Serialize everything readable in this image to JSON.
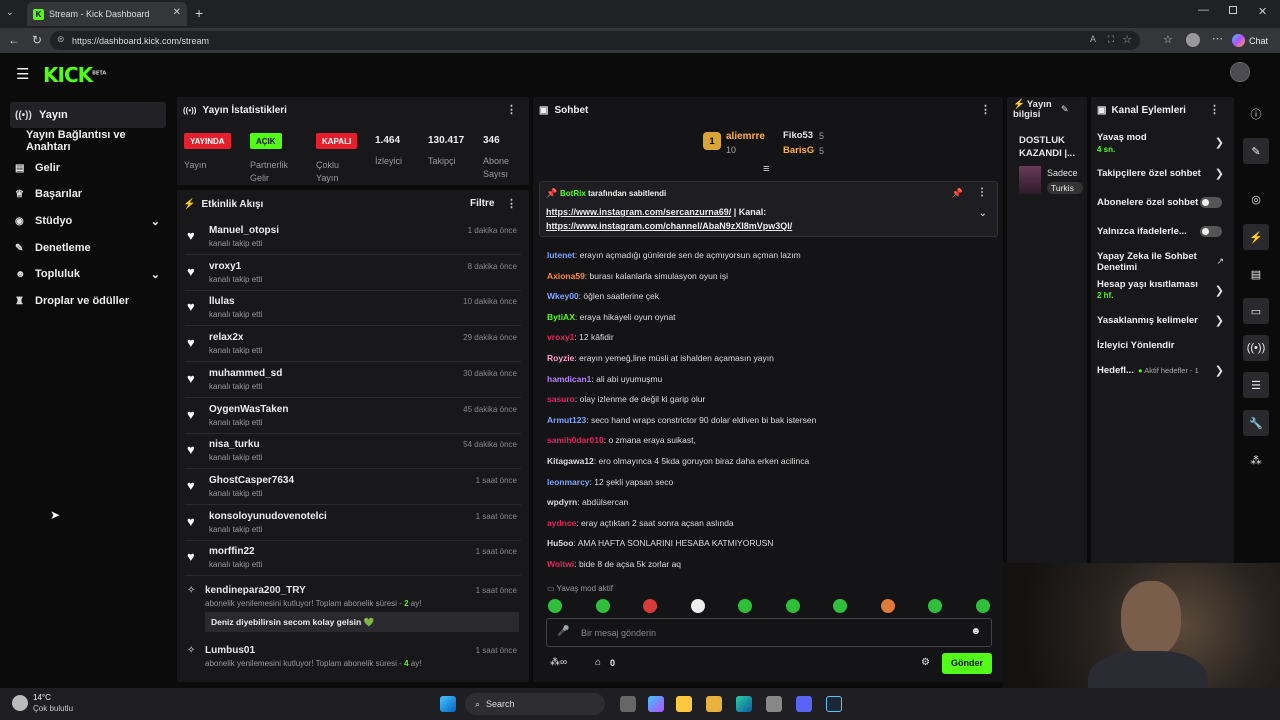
{
  "browser": {
    "tab_title": "Stream - Kick Dashboard",
    "url": "https://dashboard.kick.com/stream",
    "chat_button": "Chat"
  },
  "app": {
    "logo": "KICK",
    "logo_sup": "BETA"
  },
  "sidebar": {
    "items": [
      {
        "label": "Yayın",
        "icon": "broadcast-icon"
      },
      {
        "label": "Yayın Bağlantısı ve Anahtarı",
        "icon": ""
      },
      {
        "label": "Gelir",
        "icon": "chart-icon"
      },
      {
        "label": "Başarılar",
        "icon": "trophy-icon"
      },
      {
        "label": "Stüdyo",
        "icon": "palette-icon"
      },
      {
        "label": "Denetleme",
        "icon": "wrench-icon"
      },
      {
        "label": "Topluluk",
        "icon": "people-icon"
      },
      {
        "label": "Droplar ve ödüller",
        "icon": "gift-icon"
      }
    ]
  },
  "stats": {
    "title": "Yayın İstatistikleri",
    "yayin_badge": "YAYINDA",
    "yayin_label": "Yayın",
    "partner_badge": "AÇIK",
    "partner_label": "Partnerlik Gelir",
    "multi_badge": "KAPALI",
    "multi_label": "Çoklu Yayın",
    "viewers": "1.464",
    "viewers_label": "İzleyici",
    "followers": "130.417",
    "followers_label": "Takipçi",
    "subs": "346",
    "subs_label": "Abone Sayısı"
  },
  "activity": {
    "title": "Etkinlik Akışı",
    "filter": "Filtre",
    "items": [
      {
        "name": "Manuel_otopsi",
        "sub": "kanalı takip etti",
        "time": "1 dakika önce"
      },
      {
        "name": "vroxy1",
        "sub": "kanalı takip etti",
        "time": "8 dakika önce"
      },
      {
        "name": "llulas",
        "sub": "kanalı takip etti",
        "time": "10 dakika önce"
      },
      {
        "name": "relax2x",
        "sub": "kanalı takip etti",
        "time": "29 dakika önce"
      },
      {
        "name": "muhammed_sd",
        "sub": "kanalı takip etti",
        "time": "30 dakika önce"
      },
      {
        "name": "OygenWasTaken",
        "sub": "kanalı takip etti",
        "time": "45 dakika önce"
      },
      {
        "name": "nisa_turku",
        "sub": "kanalı takip etti",
        "time": "54 dakika önce"
      },
      {
        "name": "GhostCasper7634",
        "sub": "kanalı takip etti",
        "time": "1 saat önce"
      },
      {
        "name": "konsoloyunudovenotelci",
        "sub": "kanalı takip etti",
        "time": "1 saat önce"
      },
      {
        "name": "morffin22",
        "sub": "kanalı takip etti",
        "time": "1 saat önce"
      }
    ],
    "subs": [
      {
        "name": "kendinepara200_TRY",
        "pre": "abonelik yenilemesini kutluyor! Toplam abonelik süresi - ",
        "n": "2",
        "post": " ay!",
        "time": "1 saat önce",
        "msg": "Deniz diyebilirsin secom kolay gelsin 💚"
      },
      {
        "name": "Lumbus01",
        "pre": "abonelik yenilemesini kutluyor! Toplam abonelik süresi - ",
        "n": "4",
        "post": " ay!",
        "time": "1 saat önce"
      }
    ]
  },
  "chat": {
    "title": "Sohbet",
    "leader1": "aliemrre",
    "leader1_count": "10",
    "leader2": "Fiko53",
    "leader2_count": "5",
    "leader3": "BarisG",
    "leader3_count": "5",
    "pinned_by": "BotRix",
    "pinned_suffix": "tarafından sabitlendi",
    "pinned_link1": "https://www.instagram.com/sercanzurna69/",
    "pinned_sep": " | Kanal:",
    "pinned_link2": "https://www.instagram.com/channel/AbaN9zXI8mVpw3QI/",
    "messages": [
      {
        "user": "lutenet",
        "color": "#7ea7ff",
        "text": "erayın açmadığı günlerde sen de açmıyorsun açman lazım"
      },
      {
        "user": "Axiona59",
        "color": "#ff8a3d",
        "text": "burası kalanlarla simulasyon oyun işi"
      },
      {
        "user": "Wkey00",
        "color": "#7ea7ff",
        "text": "öğlen saatlerine çek"
      },
      {
        "user": "BytiAX",
        "color": "#53fc18",
        "text": "eraya hikayeli oyun oynat"
      },
      {
        "user": "vroxy1",
        "color": "#e0245e",
        "text": "12 kâfidir"
      },
      {
        "user": "Royzie",
        "color": "#ff9ecb",
        "text": "erayın yemeğ,line müsli at ishalden açamasın yayın"
      },
      {
        "user": "hamdican1",
        "color": "#b77cff",
        "text": "ali abi uyumuşmu"
      },
      {
        "user": "sasuro",
        "color": "#e0245e",
        "text": "olay izlenme de değil ki garip olur"
      },
      {
        "user": "Armut123",
        "color": "#7ea7ff",
        "text": "seco hand wraps constrictor 90 dolar eldiven bi bak istersen"
      },
      {
        "user": "samih0dar010",
        "color": "#e0245e",
        "text": "o zmana eraya suikast,"
      },
      {
        "user": "Kitagawa12",
        "color": "#ddd",
        "text": "ero olmayınca 4 5kda goruyon biraz daha erken acilinca"
      },
      {
        "user": "leonmarcy",
        "color": "#7ea7ff",
        "text": "12 şekli yapsan seco"
      },
      {
        "user": "wpdyrn",
        "color": "#ddd",
        "text": "abdülsercan"
      },
      {
        "user": "aydnce",
        "color": "#e0245e",
        "text": "eray açtıktan 2 saat sonra açsan aslında"
      },
      {
        "user": "Hu5oo",
        "color": "#ddd",
        "text": "AMA HAFTA SONLARINI HESABA KATMIYORUSN"
      },
      {
        "user": "Woltwi",
        "color": "#e0245e",
        "text": "bide 8 de açsa 5k zorlar aq"
      }
    ],
    "slow_notice": "Yavaş mod aktif",
    "input_placeholder": "Bir mesaj gönderin",
    "send": "Gönder",
    "coins": "0"
  },
  "info": {
    "title": "Yayın bilgisi",
    "stream_title": "DOSTLUK KAZANDI |...",
    "category": "Sadece",
    "tag": "Turkis"
  },
  "actions": {
    "title": "Kanal Eylemleri",
    "slow": "Yavaş mod",
    "slow_val": "4 sn.",
    "followers_only": "Takipçilere özel sohbet",
    "subs_only": "Abonelere özel sohbet",
    "emote_only": "Yalnızca ifadelerle...",
    "ai": "Yapay Zeka ile Sohbet Denetimi",
    "age": "Hesap yaşı kısıtlaması",
    "age_val": "2 hf.",
    "banned": "Yasaklanmış kelimeler",
    "redirect": "İzleyici Yönlendir",
    "goals": "Hedefl...",
    "goals_val": "Aktif hedefler - 1"
  },
  "taskbar": {
    "temp": "14°C",
    "weather": "Çok bulutlu",
    "search": "Search"
  }
}
